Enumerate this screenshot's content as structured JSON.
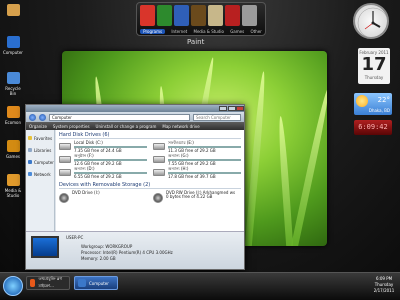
{
  "dock": {
    "tabs": [
      "Programs",
      "Internet",
      "Media & Studio",
      "Games",
      "Other"
    ],
    "active_tab": "Programs",
    "hover_label": "Paint",
    "icon_colors": [
      "#d9352b",
      "#2d8a2d",
      "#2f5fb8",
      "#6b4a1c",
      "#c7b78a",
      "#b82020",
      "#9b9b9b"
    ]
  },
  "desktop_icons": [
    {
      "label": "",
      "color": "#d6a04c"
    },
    {
      "label": "Computer",
      "color": "#2a6fd0"
    },
    {
      "label": "Recycle Bin",
      "color": "#4a8ad8"
    },
    {
      "label": "Ecomon",
      "color": "#e08a1c"
    },
    {
      "label": "Games",
      "color": "#d38b12"
    },
    {
      "label": "Media & Studio",
      "color": "#e09a2c"
    }
  ],
  "explorer": {
    "address": "Computer",
    "search_placeholder": "Search Computer",
    "toolbar": [
      "Organize",
      "System properties",
      "Uninstall or change a program",
      "Map network drive"
    ],
    "nav": [
      {
        "label": "Favorites",
        "color": "#e8c23a"
      },
      {
        "label": "Libraries",
        "color": "#8fa8c8"
      },
      {
        "label": "Computer",
        "color": "#3b78c9"
      },
      {
        "label": "Network",
        "color": "#4a8ad8"
      }
    ],
    "hdd_header": "Hard Disk Drives (6)",
    "drives": [
      {
        "name": "Local Disk (C:)",
        "free": "7.35 GB free of 24.4 GB",
        "used": 0.7
      },
      {
        "name": "সফটওয়্যার (E:)",
        "free": "11.3 GB free of 29.2 GB",
        "used": 0.61
      },
      {
        "name": "অনুষ্ঠান (F:)",
        "free": "12.6 GB free of 29.2 GB",
        "used": 0.57
      },
      {
        "name": "অন্যান্য (G:)",
        "free": "7.55 GB free of 29.2 GB",
        "used": 0.74
      },
      {
        "name": "অন্যান্য (D:)",
        "free": "6.55 GB free of 29.2 GB",
        "used": 0.78
      },
      {
        "name": "অন্যান্য (H:)",
        "free": "17.8 GB free of 39.7 GB",
        "used": 0.55
      }
    ],
    "removable_header": "Devices with Removable Storage (2)",
    "removable": [
      {
        "name": "DVD Drive (I:)",
        "free": ""
      },
      {
        "name": "DVD RW Drive (J:) Arkhangmed ws",
        "free": "0 bytes free of 4.22 GB"
      }
    ],
    "details": {
      "name": "USER-PC",
      "rows": [
        "Workgroup: WORKGROUP",
        "Processor: Intel(R) Pentium(R) 4 CPU 3.00GHz",
        "Memory: 2.00 GB"
      ]
    }
  },
  "gadgets": {
    "calendar": {
      "month": "February 2011",
      "day": "17",
      "weekday": "Thursday"
    },
    "weather": {
      "temp": "22°",
      "city": "Dhaka, BD"
    },
    "digital_clock": "6:09:42"
  },
  "taskbar": {
    "buttons": [
      {
        "label": "তথ্যপ্রযুক্তি ব্লগ মাইক্রো...",
        "color": "#e8591a"
      },
      {
        "label": "Computer",
        "color": "#3b78c9"
      }
    ],
    "tray": {
      "time": "6:09 PM",
      "day": "Thursday",
      "date": "2/17/2011"
    }
  }
}
